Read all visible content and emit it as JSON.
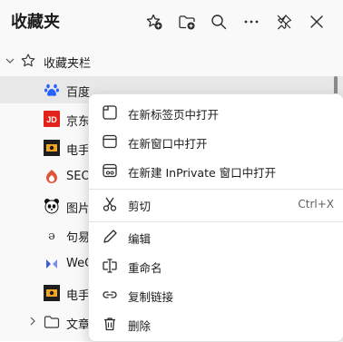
{
  "header": {
    "title": "收藏夹"
  },
  "root": {
    "label": "收藏夹栏"
  },
  "favorites": [
    {
      "label": "百度",
      "icon": "baidu-paw-icon"
    },
    {
      "label": "京东",
      "icon": "jd-logo-icon"
    },
    {
      "label": "电手",
      "icon": "site-logo-icon"
    },
    {
      "label": "SEO",
      "icon": "seo-logo-icon"
    },
    {
      "label": "图片",
      "icon": "panda-logo-icon"
    },
    {
      "label": "句易",
      "icon": "site-logo-icon"
    },
    {
      "label": "WeC",
      "icon": "wechat-logo-icon"
    },
    {
      "label": "电手",
      "icon": "site-logo-icon"
    },
    {
      "label": "文章",
      "icon": "folder-icon"
    }
  ],
  "context_menu": {
    "items": [
      {
        "label": "在新标签页中打开",
        "shortcut": ""
      },
      {
        "label": "在新窗口中打开",
        "shortcut": ""
      },
      {
        "label": "在新建 InPrivate 窗口中打开",
        "shortcut": ""
      },
      {
        "label": "剪切",
        "shortcut": "Ctrl+X"
      },
      {
        "label": "编辑",
        "shortcut": ""
      },
      {
        "label": "重命名",
        "shortcut": ""
      },
      {
        "label": "复制链接",
        "shortcut": ""
      },
      {
        "label": "删除",
        "shortcut": ""
      }
    ]
  },
  "colors": {
    "accent": "#2962ff",
    "jd_red": "#e2231a",
    "site_orange": "#f5a623"
  }
}
